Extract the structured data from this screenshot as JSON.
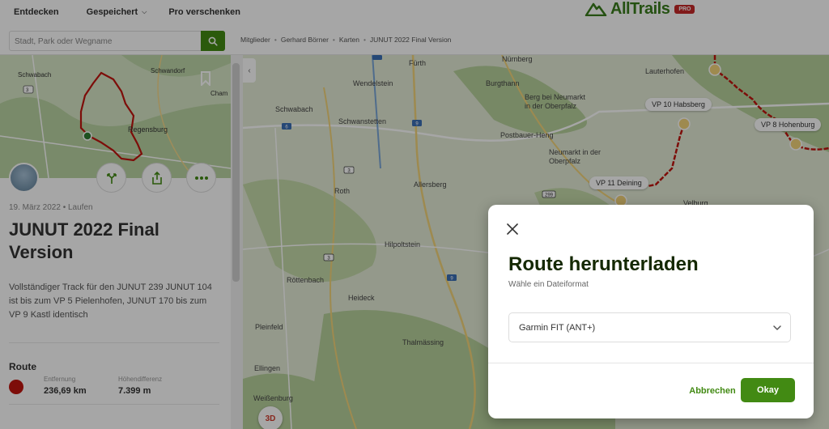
{
  "nav": {
    "items": [
      {
        "label": "Entdecken",
        "has_dropdown": false
      },
      {
        "label": "Gespeichert",
        "has_dropdown": true
      },
      {
        "label": "Pro verschenken",
        "has_dropdown": false
      }
    ],
    "logo_text": "AllTrails",
    "pro_badge": "PRO",
    "brand_color": "#428a13"
  },
  "search": {
    "placeholder": "Stadt, Park oder Wegname",
    "icon": "search-icon"
  },
  "breadcrumb": [
    "Mitglieder",
    "Gerhard Börner",
    "Karten",
    "JUNUT 2022 Final Version"
  ],
  "route": {
    "date_activity": "19. März 2022 • Laufen",
    "title": "JUNUT 2022 Final Version",
    "description": "Vollständiger Track für den JUNUT 239 JUNUT 104 ist bis zum VP 5 Pielenhofen, JUNUT 170 bis zum VP 9 Kastl identisch",
    "section_label": "Route",
    "route_color": "#c0140e",
    "stats": [
      {
        "label": "Entfernung",
        "value": "236,69 km"
      },
      {
        "label": "Höhendifferenz",
        "value": "7.399 m"
      }
    ]
  },
  "thumbnail": {
    "labels": [
      "Schwabach",
      "Schwandorf",
      "Regensburg",
      "Cham"
    ]
  },
  "map": {
    "places": [
      "Fürth",
      "Nürnberg",
      "Lauterhofen",
      "Wendelstein",
      "Burgthann",
      "Schwabach",
      "Berg bei Neumarkt in der Oberpfalz",
      "Schwanstetten",
      "Postbauer-Heng",
      "Neumarkt in der Oberpfalz",
      "Roth",
      "Allersberg",
      "Velburg",
      "Hilpoltstein",
      "Röttenbach",
      "Heideck",
      "Pleinfeld",
      "Thalmässing",
      "Ellingen",
      "Weißenburg"
    ],
    "vp_labels": [
      "VP 10 Habsberg",
      "VP 8 Hohenburg",
      "VP 11 Deining"
    ],
    "road_shields": [
      "6",
      "3",
      "9",
      "2",
      "299"
    ],
    "btn_3d": "3D"
  },
  "modal": {
    "title": "Route herunterladen",
    "subtitle": "Wähle ein Dateiformat",
    "selected_format": "Garmin FIT (ANT+)",
    "cancel_label": "Abbrechen",
    "ok_label": "Okay"
  }
}
